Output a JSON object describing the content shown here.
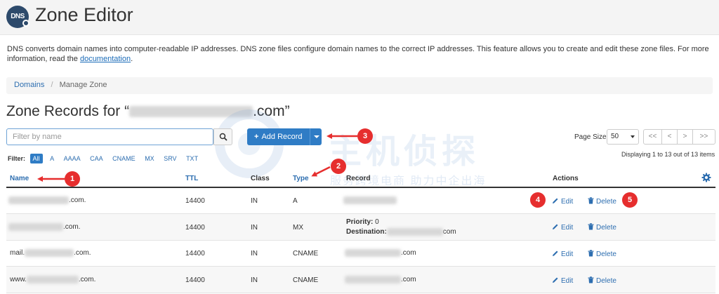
{
  "app": {
    "title": "Zone Editor",
    "logo_text": "DNS"
  },
  "intro": {
    "text": "DNS converts domain names into computer-readable IP addresses. DNS zone files configure domain names to the correct IP addresses. This feature allows you to create and edit these zone files. For more information, read the ",
    "link": "documentation",
    "end": "."
  },
  "breadcrumb": {
    "items": [
      "Domains",
      "Manage Zone"
    ],
    "separator": "/"
  },
  "records": {
    "title_prefix": "Zone Records for “",
    "title_suffix": ".com”"
  },
  "search": {
    "placeholder": "Filter by name"
  },
  "add_record": {
    "label": "Add Record",
    "icon": "plus-icon"
  },
  "filter": {
    "label": "Filter:",
    "options": [
      "All",
      "A",
      "AAAA",
      "CAA",
      "CNAME",
      "MX",
      "SRV",
      "TXT"
    ],
    "active": "All"
  },
  "pagination": {
    "page_size_label": "Page Size",
    "page_size": "50",
    "buttons": [
      "<<",
      "<",
      ">",
      ">>"
    ],
    "display": "Displaying 1 to 13 out of 13 items"
  },
  "table": {
    "headers": {
      "name": "Name",
      "ttl": "TTL",
      "class": "Class",
      "type": "Type",
      "record": "Record",
      "actions": "Actions"
    },
    "rows": [
      {
        "name_suffix": ".com.",
        "ttl": "14400",
        "class": "IN",
        "type": "A"
      },
      {
        "name_suffix": ".com.",
        "ttl": "14400",
        "class": "IN",
        "type": "MX",
        "priority_label": "Priority:",
        "priority": "0",
        "destination_label": "Destination:",
        "destination_suffix": "com"
      },
      {
        "name_prefix": "mail.",
        "name_suffix": ".com.",
        "ttl": "14400",
        "class": "IN",
        "type": "CNAME",
        "record_suffix": ".com"
      },
      {
        "name_prefix": "www.",
        "name_suffix": ".com.",
        "ttl": "14400",
        "class": "IN",
        "type": "CNAME",
        "record_suffix": ".com"
      }
    ],
    "edit_label": "Edit",
    "delete_label": "Delete"
  },
  "annotations": [
    "1",
    "2",
    "3",
    "4",
    "5"
  ],
  "watermark": {
    "line1": "主机侦探",
    "line2": "服务跨境电商 助力中企出海"
  },
  "colors": {
    "accent": "#2f7cc5",
    "link": "#2d6eb0",
    "annotation": "#e62e2e",
    "header_bg": "#f4f4f4"
  }
}
